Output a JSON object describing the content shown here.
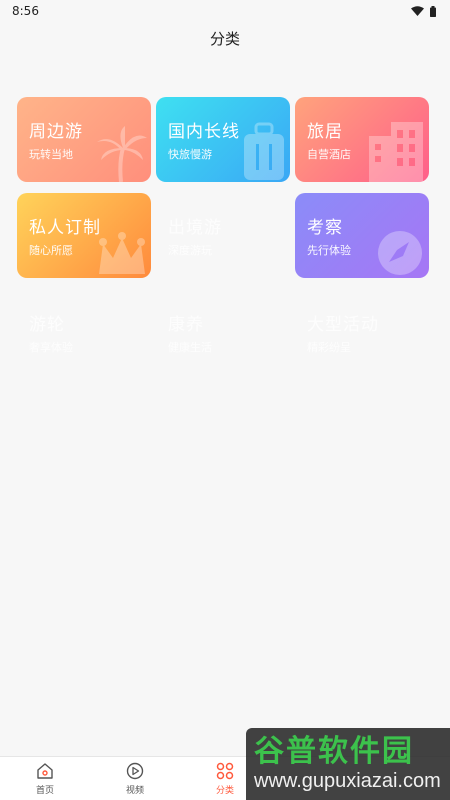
{
  "status_bar": {
    "time": "8:56"
  },
  "header": {
    "title": "分类"
  },
  "categories": [
    {
      "title": "周边游",
      "subtitle": "玩转当地"
    },
    {
      "title": "国内长线",
      "subtitle": "快旅慢游"
    },
    {
      "title": "旅居",
      "subtitle": "自营酒店"
    },
    {
      "title": "私人订制",
      "subtitle": "随心所愿"
    },
    {
      "title": "出境游",
      "subtitle": "深度游玩"
    },
    {
      "title": "考察",
      "subtitle": "先行体验"
    },
    {
      "title": "游轮",
      "subtitle": "奢享体验"
    },
    {
      "title": "康养",
      "subtitle": "健康生活"
    },
    {
      "title": "大型活动",
      "subtitle": "精彩纷呈"
    }
  ],
  "tabbar": {
    "items": [
      {
        "label": "首页",
        "icon": "home-icon"
      },
      {
        "label": "视频",
        "icon": "play-icon"
      },
      {
        "label": "分类",
        "icon": "grid-icon"
      }
    ],
    "active_index": 2,
    "active_color": "#ff5a3d"
  },
  "watermark": {
    "cn": "谷普软件园",
    "en": "www.gupuxiazai.com"
  }
}
